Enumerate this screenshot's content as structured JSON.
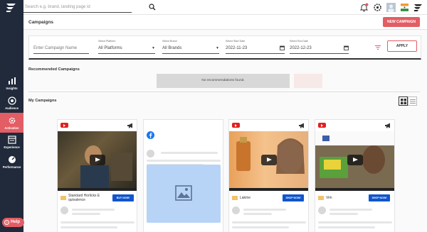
{
  "search": {
    "placeholder": "Search e.g. brand, landing page id"
  },
  "sidebar": {
    "items": [
      {
        "label": "Insights",
        "icon": "bar-chart-icon"
      },
      {
        "label": "Audience",
        "icon": "target-icon"
      },
      {
        "label": "Activation",
        "icon": "gear-icon"
      },
      {
        "label": "Experience",
        "icon": "layout-icon"
      },
      {
        "label": "Performance",
        "icon": "gauge-icon"
      }
    ],
    "active": "Activation"
  },
  "header": {
    "title": "Campaigns",
    "new_campaign": "NEW CAMPAIGN"
  },
  "filters": {
    "campaign_name_placeholder": "Enter Campaign Name",
    "platform": {
      "label": "Select Platform",
      "value": "All Platforms"
    },
    "brand": {
      "label": "Select Brand",
      "value": "All Brands"
    },
    "start_date": {
      "label": "Select Start Date",
      "value": "2022-11-23"
    },
    "end_date": {
      "label": "Select End Date",
      "value": "2022-12-23"
    },
    "apply": "APPLY"
  },
  "recommended": {
    "title": "Recommended Campaigns",
    "empty": "No recommendations found."
  },
  "my_campaigns": {
    "title": "My Campaigns",
    "cards": [
      {
        "platform": "youtube",
        "brand": "Standard Horlicks E quivalence",
        "cta": "BUY NOW!"
      },
      {
        "platform": "facebook"
      },
      {
        "platform": "youtube",
        "brand": "Lakme",
        "cta": "SHOP NOW!"
      },
      {
        "platform": "youtube",
        "brand": "Vim",
        "cta": "SHOP NOW!"
      }
    ]
  },
  "help": {
    "label": "Help"
  },
  "colors": {
    "accent": "#e35d64",
    "sidebar": "#202a3b",
    "cta_blue": "#1155cc"
  }
}
